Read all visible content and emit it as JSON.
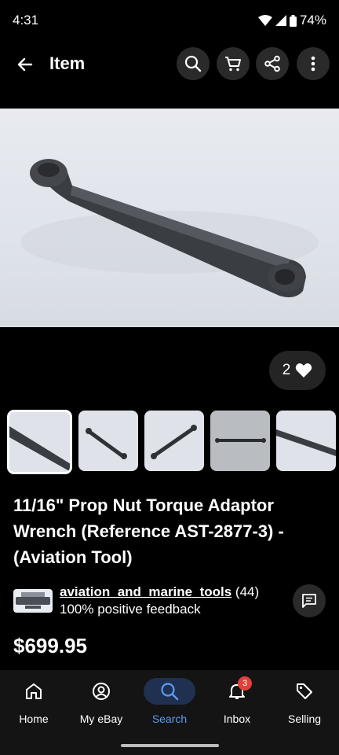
{
  "status_bar": {
    "time": "4:31",
    "battery": "74%"
  },
  "app_bar": {
    "title": "Item"
  },
  "listing": {
    "like_count": "2",
    "title": "11/16\" Prop Nut Torque Adaptor Wrench (Reference AST-2877-3) - (Aviation Tool)",
    "price": "$699.95",
    "thumbnail_count": 5,
    "selected_thumbnail": 1
  },
  "seller": {
    "name": "aviation_and_marine_tools",
    "rating_count": "(44)",
    "feedback": "100% positive feedback"
  },
  "bottom_nav": {
    "items": [
      {
        "label": "Home",
        "icon": "home-icon"
      },
      {
        "label": "My eBay",
        "icon": "account-icon"
      },
      {
        "label": "Search",
        "icon": "search-icon"
      },
      {
        "label": "Inbox",
        "icon": "bell-icon",
        "badge": "3"
      },
      {
        "label": "Selling",
        "icon": "tag-icon"
      }
    ],
    "active": "Search"
  },
  "colors": {
    "accent": "#5b9cf2",
    "badge": "#e0413a",
    "background": "#000000"
  }
}
